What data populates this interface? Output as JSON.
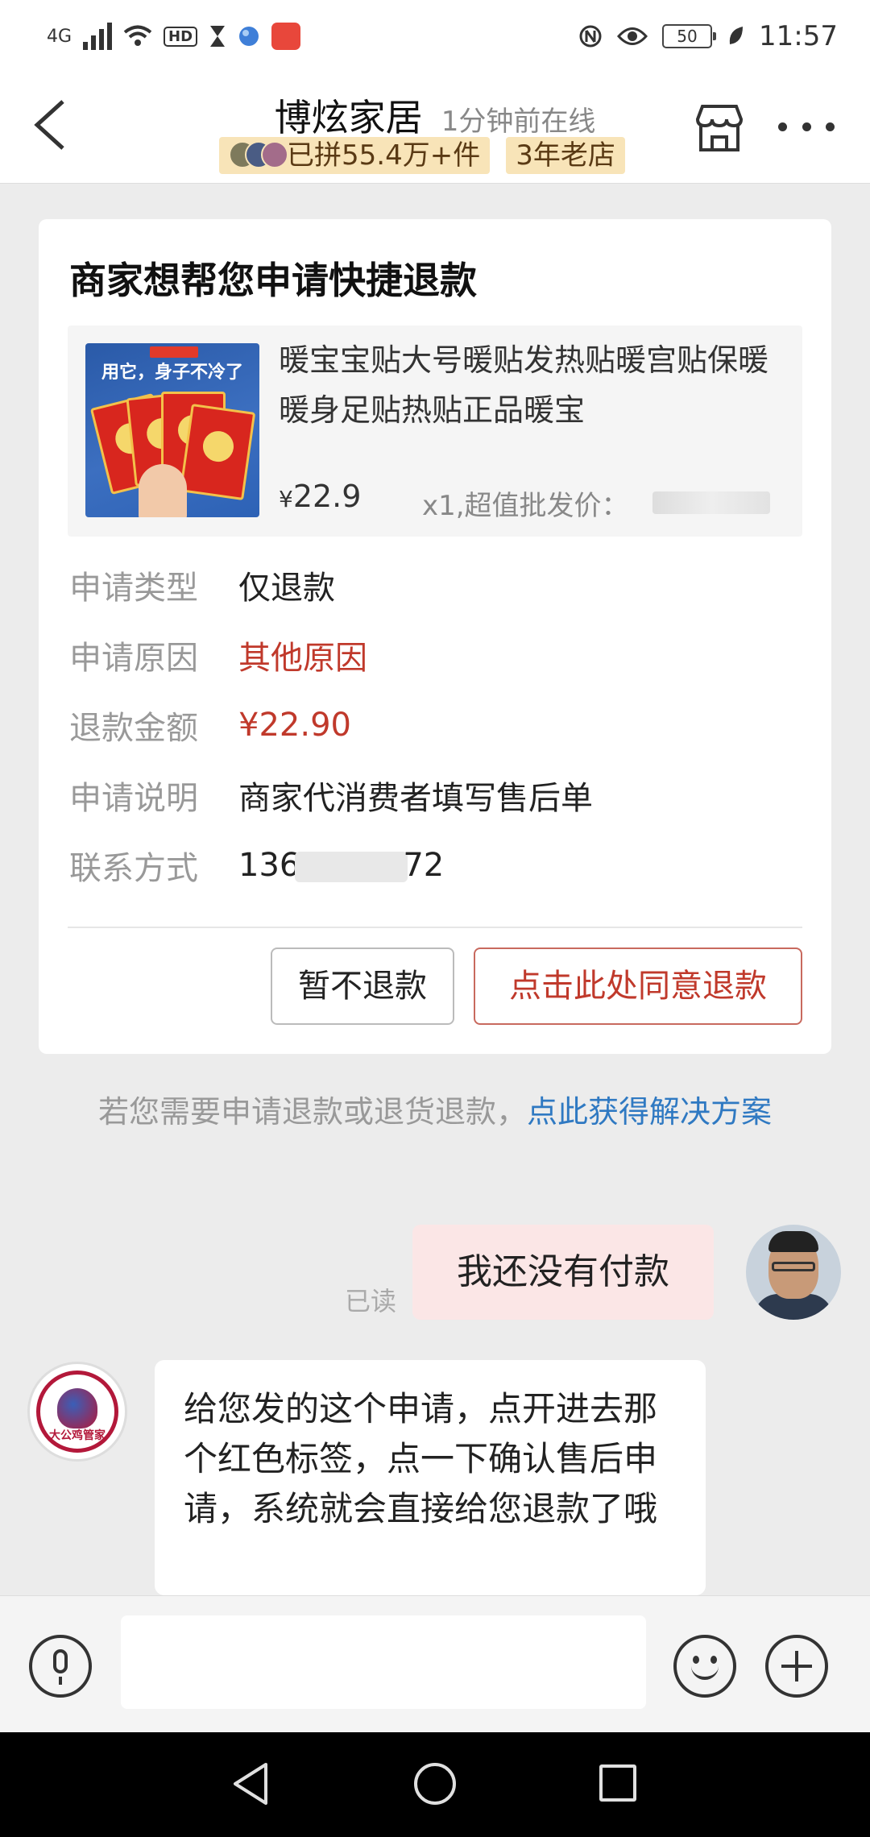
{
  "status_bar": {
    "network": "4G",
    "hd_label": "HD",
    "battery_level": "50",
    "time": "11:57"
  },
  "header": {
    "shop_name": "博炫家居",
    "online_status": "1分钟前在线",
    "tag_sold": "已拼55.4万+件",
    "tag_age": "3年老店"
  },
  "refund_card": {
    "title": "商家想帮您申请快捷退款",
    "product": {
      "image_caption": "用它，身子不冷了",
      "name": "暖宝宝贴大号暖贴发热贴暖宫贴保暖暖身足贴热贴正品暖宝",
      "currency": "¥",
      "price": "22.9",
      "quantity_note": "x1,超值批发价："
    },
    "fields": [
      {
        "label": "申请类型",
        "value": "仅退款"
      },
      {
        "label": "申请原因",
        "value": "其他原因"
      },
      {
        "label": "退款金额",
        "value": "¥22.90"
      },
      {
        "label": "申请说明",
        "value": "商家代消费者填写售后单"
      },
      {
        "label": "联系方式",
        "value_prefix": "136",
        "value_suffix": "72"
      }
    ],
    "cancel_button": "暂不退款",
    "agree_button": "点击此处同意退款",
    "accent_color": "#c0392b"
  },
  "notice": {
    "text": "若您需要申请退款或退货退款，",
    "link": "点此获得解决方案"
  },
  "messages": [
    {
      "side": "right",
      "status": "已读",
      "text": "我还没有付款"
    },
    {
      "side": "left",
      "avatar_label": "大公鸡管家",
      "text": "给您发的这个申请，点开进去那个红色标签，点一下确认售后申请，系统就会直接给您退款了哦"
    }
  ],
  "input_bar": {
    "placeholder": ""
  }
}
